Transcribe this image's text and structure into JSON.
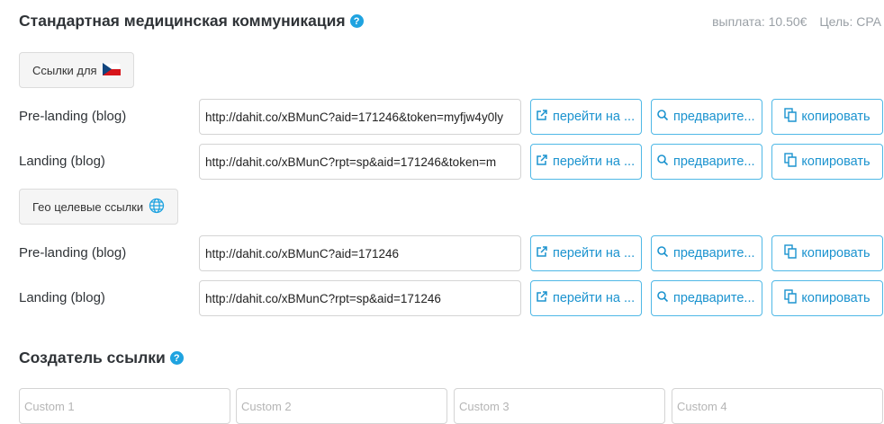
{
  "header": {
    "title": "Стандартная медицинская коммуникация",
    "help": "?",
    "payout": "выплата: 10.50€",
    "goal": "Цель: CPA"
  },
  "links_for": {
    "label": "Ссылки для"
  },
  "standard_links": [
    {
      "label": "Pre-landing (blog)",
      "url": "http://dahit.co/xBMunC?aid=171246&token=myfjw4y0ly"
    },
    {
      "label": "Landing (blog)",
      "url": "http://dahit.co/xBMunC?rpt=sp&aid=171246&token=m"
    }
  ],
  "geo_links": {
    "label": "Гео целевые ссылки"
  },
  "geo_rows": [
    {
      "label": "Pre-landing (blog)",
      "url": "http://dahit.co/xBMunC?aid=171246"
    },
    {
      "label": "Landing (blog)",
      "url": "http://dahit.co/xBMunC?rpt=sp&aid=171246"
    }
  ],
  "actions": {
    "go": "перейти на ...",
    "preview": "предварите...",
    "copy": "копировать"
  },
  "link_builder": {
    "title": "Создатель ссылки",
    "help": "?",
    "custom_placeholders": [
      "Custom 1",
      "Custom 2",
      "Custom 3",
      "Custom 4"
    ]
  },
  "colors": {
    "accent": "#1b93cf",
    "help_badge": "#1fa3e0"
  },
  "icons": {
    "flag": "czech-flag-icon",
    "globe": "globe-icon",
    "go": "external-link-icon",
    "preview": "search-icon",
    "copy": "copy-icon"
  }
}
